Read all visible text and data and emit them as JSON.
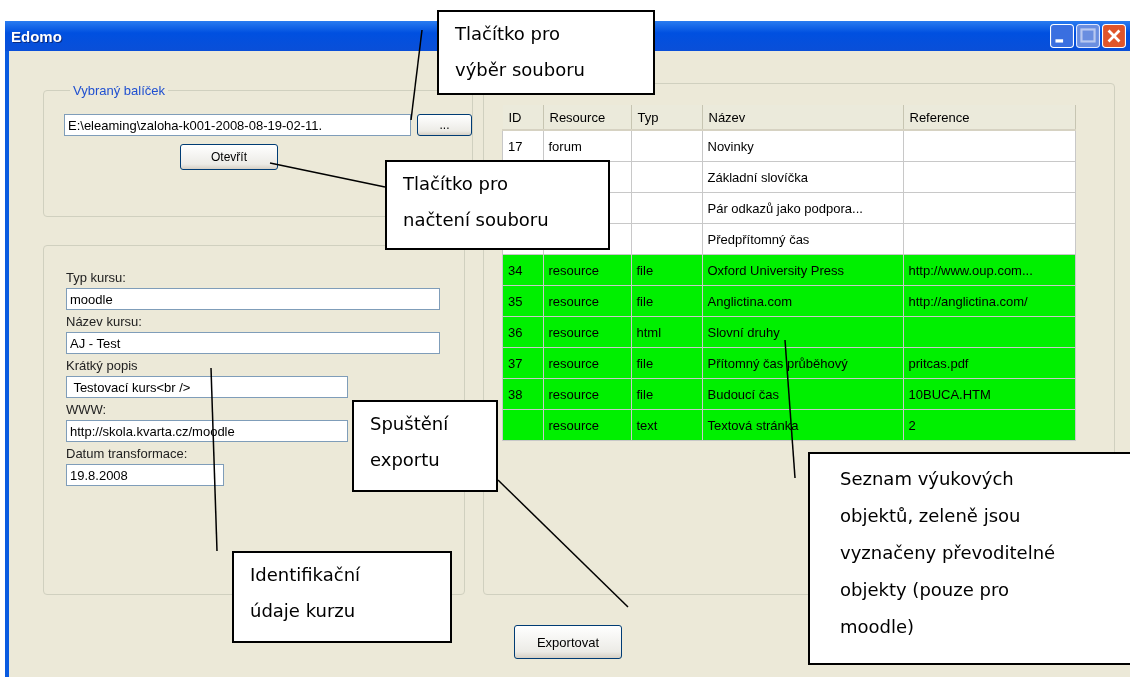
{
  "window": {
    "title": "Edomo"
  },
  "package_group": {
    "label": "Vybraný balíček",
    "path": "E:\\eleaming\\zaloha-k001-2008-08-19-02-11.",
    "browse_label": "...",
    "open_label": "Otevřít"
  },
  "course_fields": [
    {
      "label": "Typ kursu:",
      "value": "moodle",
      "kind": "text"
    },
    {
      "label": "Název kursu:",
      "value": "AJ - Test",
      "kind": "text"
    },
    {
      "label": "Krátký popis",
      "value": " Testovací kurs<br />",
      "kind": "text"
    },
    {
      "label": "WWW:",
      "value": "http://skola.kvarta.cz/moodle",
      "kind": "text"
    },
    {
      "label": "Datum transformace:",
      "value": "19.8.2008",
      "kind": "date"
    }
  ],
  "table": {
    "columns": [
      "ID",
      "Resource",
      "Typ",
      "Název",
      "Reference"
    ],
    "rows": [
      {
        "cells": [
          "17",
          "forum",
          null,
          "Novinky",
          null
        ],
        "convertible": false
      },
      {
        "cells": [
          null,
          null,
          null,
          "Základní slovíčka",
          null
        ],
        "convertible": false
      },
      {
        "cells": [
          null,
          null,
          null,
          " Pár odkazů jako podpora...",
          null
        ],
        "convertible": false
      },
      {
        "cells": [
          null,
          null,
          null,
          "Předpřítomný čas",
          null
        ],
        "convertible": false
      },
      {
        "cells": [
          "34",
          "resource",
          "file",
          "Oxford University Press",
          "http://www.oup.com..."
        ],
        "convertible": true
      },
      {
        "cells": [
          "35",
          "resource",
          "file",
          "Anglictina.com",
          "http://anglictina.com/"
        ],
        "convertible": true
      },
      {
        "cells": [
          "36",
          "resource",
          "html",
          "Slovní druhy",
          null
        ],
        "convertible": true
      },
      {
        "cells": [
          "37",
          "resource",
          "file",
          "Přítomný čas průběhový",
          "pritcas.pdf"
        ],
        "convertible": true
      },
      {
        "cells": [
          "38",
          "resource",
          "file",
          "Budoucí čas",
          "10BUCA.HTM"
        ],
        "convertible": true
      },
      {
        "cells": [
          null,
          "resource",
          "text",
          "Textová stránka",
          "2"
        ],
        "convertible": true
      }
    ]
  },
  "export_label": "Exportovat",
  "callouts": [
    {
      "lines": [
        "Tlačítko pro",
        "výběr souboru"
      ]
    },
    {
      "lines": [
        "Tlačítko pro",
        "načtení souboru"
      ]
    },
    {
      "lines": [
        "Spuštění",
        "exportu"
      ]
    },
    {
      "lines": [
        "Identifikační",
        "údaje kurzu"
      ]
    },
    {
      "lines": [
        "Seznam výukových",
        "objektů, zeleně jsou",
        "vyznačeny převoditelné",
        "objekty (pouze pro",
        "moodle)"
      ]
    }
  ]
}
